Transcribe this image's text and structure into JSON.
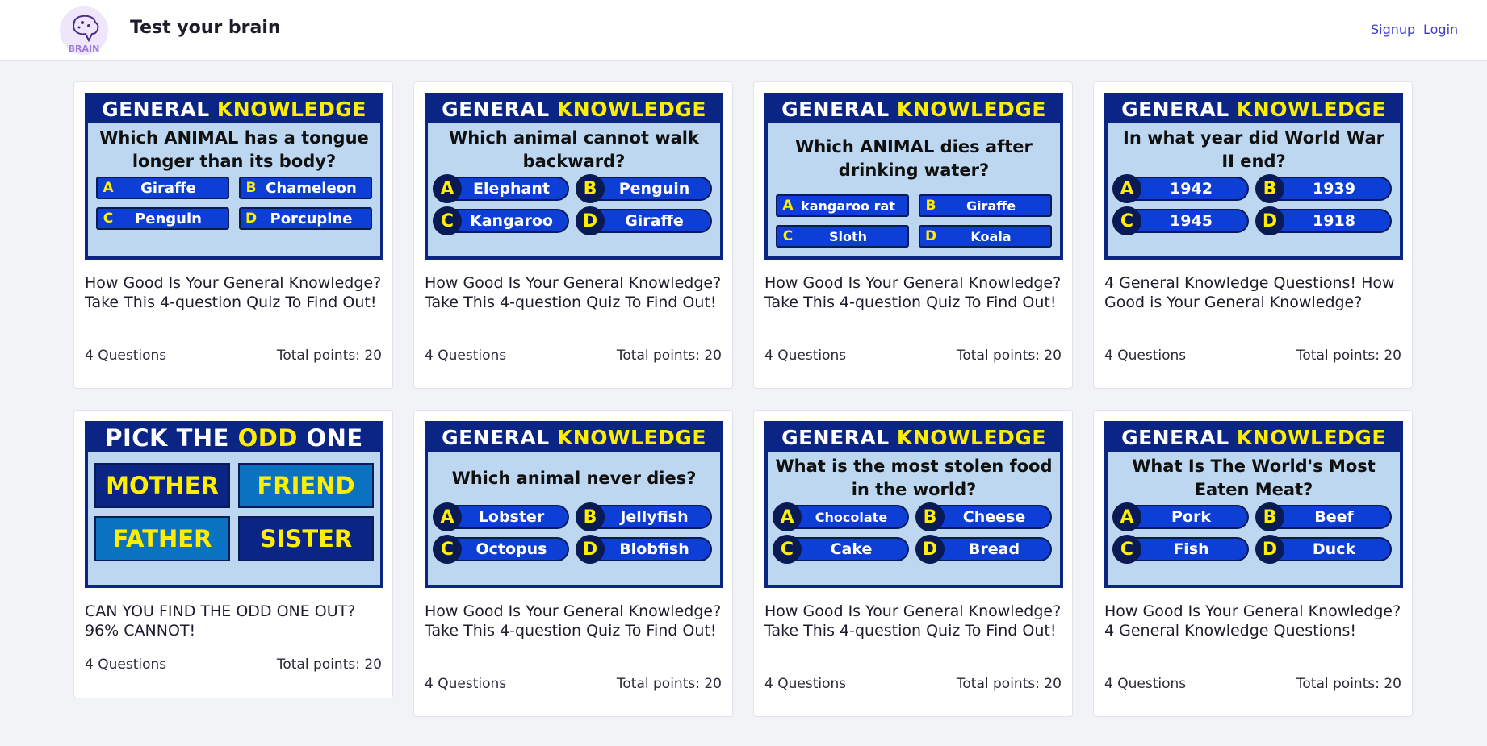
{
  "app": {
    "title": "Test your brain",
    "logo_text": "BRAIN"
  },
  "nav": {
    "signup": "Signup",
    "login": "Login"
  },
  "cards": [
    {
      "header_a": "GENERAL ",
      "header_b": "KNOWLEDGE",
      "question": "Which ANIMAL has a tongue longer than its body?",
      "answers": [
        "Giraffe",
        "Chameleon",
        "Penguin",
        "Porcupine"
      ],
      "title": "How Good Is Your General Knowledge? Take This 4-question Quiz To Find Out!",
      "questions": "4 Questions",
      "points": "Total points: 20"
    },
    {
      "header_a": "GENERAL ",
      "header_b": "KNOWLEDGE",
      "question": "Which animal cannot walk backward?",
      "answers": [
        "Elephant",
        "Penguin",
        "Kangaroo",
        "Giraffe"
      ],
      "title": "How Good Is Your General Knowledge? Take This 4-question Quiz To Find Out!",
      "questions": "4 Questions",
      "points": "Total points: 20"
    },
    {
      "header_a": "GENERAL ",
      "header_b": "KNOWLEDGE",
      "question": "Which ANIMAL dies after drinking water?",
      "answers": [
        "kangaroo rat",
        "Giraffe",
        "Sloth",
        "Koala"
      ],
      "title": "How Good Is Your General Knowledge? Take This 4-question Quiz To Find Out!",
      "questions": "4 Questions",
      "points": "Total points: 20"
    },
    {
      "header_a": "GENERAL ",
      "header_b": "KNOWLEDGE",
      "question": "In what year did World War II end?",
      "answers": [
        "1942",
        "1939",
        "1945",
        "1918"
      ],
      "title": "4 General Knowledge Questions! How Good is Your General Knowledge?",
      "questions": "4 Questions",
      "points": "Total points: 20"
    },
    {
      "header_a": "PICK THE ",
      "header_b": "ODD",
      "header_c": " ONE",
      "answers": [
        "MOTHER",
        "FRIEND",
        "FATHER",
        "SISTER"
      ],
      "title": "CAN YOU FIND THE ODD ONE OUT? 96% CANNOT!",
      "questions": "4 Questions",
      "points": "Total points: 20"
    },
    {
      "header_a": "GENERAL ",
      "header_b": "KNOWLEDGE",
      "question": "Which animal never dies?",
      "answers": [
        "Lobster",
        "Jellyfish",
        "Octopus",
        "Blobfish"
      ],
      "title": "How Good Is Your General Knowledge? Take This 4-question Quiz To Find Out!",
      "questions": "4 Questions",
      "points": "Total points: 20"
    },
    {
      "header_a": "GENERAL ",
      "header_b": "KNOWLEDGE",
      "question": "What is the most stolen food in the world?",
      "answers": [
        "Chocolate",
        "Cheese",
        "Cake",
        "Bread"
      ],
      "title": "How Good Is Your General Knowledge? Take This 4-question Quiz To Find Out!",
      "questions": "4 Questions",
      "points": "Total points: 20"
    },
    {
      "header_a": "GENERAL ",
      "header_b": "KNOWLEDGE",
      "question": "What Is The World's Most Eaten Meat?",
      "answers": [
        "Pork",
        "Beef",
        "Fish",
        "Duck"
      ],
      "title": "How Good Is Your General Knowledge? 4 General Knowledge Questions!",
      "questions": "4 Questions",
      "points": "Total points: 20"
    }
  ],
  "letters": [
    "A",
    "B",
    "C",
    "D"
  ]
}
